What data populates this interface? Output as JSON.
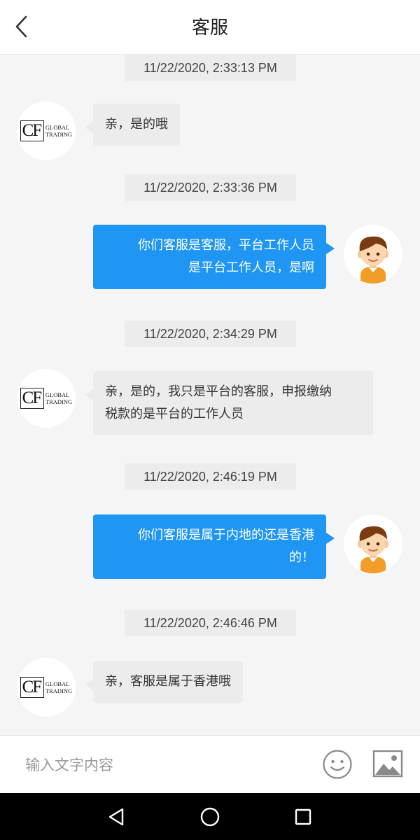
{
  "header": {
    "title": "客服",
    "back_icon": "chevron-left-icon"
  },
  "messages": [
    {
      "time": "11/22/2020, 2:33:13 PM",
      "sender": "agent",
      "text": [
        "亲，是的哦"
      ]
    },
    {
      "time": "11/22/2020, 2:33:36 PM",
      "sender": "user",
      "text": [
        "你们客服是客服，平台工作人员",
        "是平台工作人员，是啊"
      ]
    },
    {
      "time": "11/22/2020, 2:34:29 PM",
      "sender": "agent",
      "text": [
        "亲，是的，我只是平台的客服，申报缴纳",
        "税款的是平台的工作人员"
      ]
    },
    {
      "time": "11/22/2020, 2:46:19 PM",
      "sender": "user",
      "text": [
        "你们客服是属于内地的还是香港",
        "的！"
      ]
    },
    {
      "time": "11/22/2020, 2:46:46 PM",
      "sender": "agent",
      "text": [
        "亲，客服是属于香港哦"
      ]
    }
  ],
  "agent_logo": {
    "mark": "CF",
    "line1": "GLOBAL",
    "line2": "TRADING"
  },
  "input": {
    "value": "",
    "placeholder": "输入文字内容",
    "emoji_icon": "smiley-icon",
    "image_icon": "image-icon"
  },
  "colors": {
    "user_bubble": "#1f96f3",
    "agent_bubble": "#ececec",
    "background": "#f5f5f5"
  },
  "system_nav": {
    "icons": [
      "back-triangle-icon",
      "home-circle-icon",
      "recents-square-icon"
    ]
  }
}
